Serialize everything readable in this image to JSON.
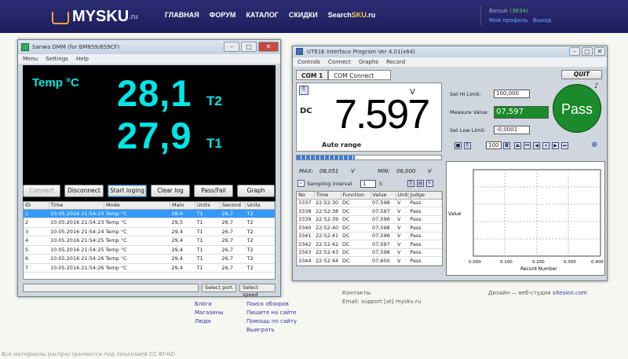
{
  "site": {
    "logo_text": "MYSKU",
    "logo_suffix": ".ru",
    "nav": [
      "ГЛАВНАЯ",
      "ФОРУМ",
      "КАТАЛОГ",
      "СКИДКИ"
    ],
    "nav_search_prefix": "Search",
    "nav_search_highlight": "SKU",
    "nav_search_suffix": ".ru",
    "user_name": "Barsuk",
    "user_rating": "(3634)",
    "user_links": [
      "Мой профиль",
      "Выход"
    ],
    "accent": "#f6c84e",
    "header_bg": "#2c2c74"
  },
  "footer": {
    "col1": [
      "Блоги",
      "Магазины",
      "Люди"
    ],
    "col2": [
      "Поиск обзоров",
      "Пишите на сайте",
      "Помощь по сайту",
      "Выиграть"
    ],
    "contacts_title": "Контакты",
    "email": "Email: support [at] mysku.ru",
    "design": "Дизайн — веб-студия",
    "design_link": "sitesion.com",
    "license": "Все материалы распространяются под лицензией CC BY-ND"
  },
  "dmm": {
    "title": "Sanwa DMM (for BM859/859CF)",
    "menu": [
      "Menu",
      "Settings",
      "Help"
    ],
    "temp_label": "Temp °C",
    "t2_value": "28,1",
    "t2_tag": "T2",
    "t1_value": "27,9",
    "t1_tag": "T1",
    "buttons": [
      "Connect",
      "Disconnect",
      "Start loging",
      "Clear log",
      "Pass/Fail",
      "Graph"
    ],
    "columns": [
      "ID",
      "Time",
      "Mode",
      "Main",
      "Units",
      "Second",
      "Units"
    ],
    "rows": [
      [
        "1",
        "10.05.2016 21:54:23",
        "Temp °C",
        "28,6",
        "T1",
        "26,7",
        "T2"
      ],
      [
        "2",
        "10.05.2016 21:54:23",
        "Temp °C",
        "29,5",
        "T1",
        "26,7",
        "T2"
      ],
      [
        "3",
        "10.05.2016 21:54:24",
        "Temp °C",
        "29,4",
        "T1",
        "26,7",
        "T2"
      ],
      [
        "4",
        "10.05.2016 21:54:25",
        "Temp °C",
        "29,4",
        "T1",
        "26,7",
        "T2"
      ],
      [
        "5",
        "10.05.2016 21:54:25",
        "Temp °C",
        "29,4",
        "T1",
        "26,7",
        "T2"
      ],
      [
        "6",
        "10.05.2016 21:54:26",
        "Temp °C",
        "29,4",
        "T1",
        "26,7",
        "T2"
      ],
      [
        "7",
        "10.05.2016 21:54:26",
        "Temp °C",
        "29,4",
        "T1",
        "26,7",
        "T2"
      ]
    ],
    "status": [
      "",
      "Select port",
      "Select speed"
    ]
  },
  "ut": {
    "title": "UT61E Interface Program Ver 4.01(x64)",
    "menu": [
      "Controls",
      "Connect",
      "Graphs",
      "Record"
    ],
    "tab_com1": "COM 1",
    "tab_connect": "COM Connect",
    "quit": "QUIT",
    "mode": "DC",
    "value": "7.597",
    "unit": "V",
    "range": "Auto range",
    "progress": 0.4,
    "max_label": "MAX:",
    "max_value": "08,051",
    "max_unit": "V",
    "min_label": "MIN:",
    "min_value": "06,000",
    "min_unit": "V",
    "hi_label": "Set HI Limit:",
    "hi_value": "100,000",
    "measure_label": "Measure Value:",
    "measure_value": "07,597",
    "low_label": "Set Low Limit:",
    "low_value": "-0,0001",
    "pass": "Pass",
    "speed_value": "100",
    "sampling_label": "Sampling interval",
    "sampling_value": "1",
    "sampling_unit": "S",
    "log_columns": [
      "No",
      "Time",
      "Function",
      "Value",
      "Unit",
      "Judge"
    ],
    "log_rows": [
      [
        "3337",
        "22:52:30",
        "DC",
        "07,598",
        "V",
        "Pass"
      ],
      [
        "3338",
        "22:52:38",
        "DC",
        "07,597",
        "V",
        "Pass"
      ],
      [
        "3339",
        "22:52:39",
        "DC",
        "07,596",
        "V",
        "Pass"
      ],
      [
        "3340",
        "22:52:40",
        "DC",
        "07,598",
        "V",
        "Pass"
      ],
      [
        "3341",
        "22:52:41",
        "DC",
        "07,596",
        "V",
        "Pass"
      ],
      [
        "3342",
        "22:52:42",
        "DC",
        "07,597",
        "V",
        "Pass"
      ],
      [
        "3343",
        "22:52:43",
        "DC",
        "07,598",
        "V",
        "Pass"
      ],
      [
        "3344",
        "22:52:44",
        "DC",
        "07,600",
        "V",
        "Pass"
      ]
    ],
    "graph_ylabel": "Value",
    "graph_xlabel": "Record Number",
    "graph_xticks": [
      "0.000",
      "0.100",
      "0.200",
      "0.300",
      "0.400"
    ]
  }
}
